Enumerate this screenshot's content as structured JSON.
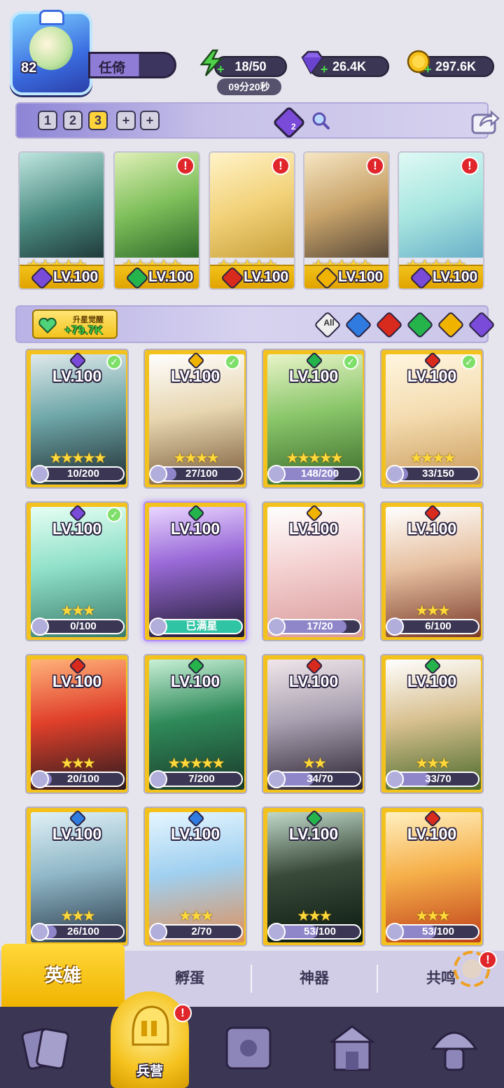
{
  "player": {
    "level": "82",
    "name": "任倚"
  },
  "resources": {
    "energy": "18/50",
    "energy_timer": "09分20秒",
    "gems": "26.4K",
    "coins": "297.6K"
  },
  "team_slots": [
    "1",
    "2",
    "3",
    "+",
    "+"
  ],
  "team_badge_count": "2",
  "team": [
    {
      "level": "LV.100",
      "element": "purple",
      "alert": false
    },
    {
      "level": "LV.100",
      "element": "green",
      "alert": true
    },
    {
      "level": "LV.100",
      "element": "red",
      "alert": true
    },
    {
      "level": "LV.100",
      "element": "gold",
      "alert": true
    },
    {
      "level": "LV.100",
      "element": "purple",
      "alert": true
    }
  ],
  "awaken": {
    "label": "升星觉醒",
    "value": "+79.7K"
  },
  "filters": {
    "all_label": "All",
    "elements": [
      "blue",
      "red",
      "green",
      "gold",
      "purple"
    ]
  },
  "heroes": [
    {
      "level": "LV.100",
      "frag": "10/200",
      "checked": true,
      "element": "purple",
      "stars": 5
    },
    {
      "level": "LV.100",
      "frag": "27/100",
      "checked": true,
      "element": "gold",
      "stars": 4
    },
    {
      "level": "LV.100",
      "frag": "148/200",
      "checked": true,
      "element": "green",
      "stars": 5
    },
    {
      "level": "LV.100",
      "frag": "33/150",
      "checked": true,
      "element": "red",
      "stars": 4
    },
    {
      "level": "LV.100",
      "frag": "0/100",
      "checked": true,
      "element": "purple",
      "stars": 3
    },
    {
      "level": "LV.100",
      "frag": "已满星",
      "checked": false,
      "element": "green",
      "stars": 0,
      "maxed": true
    },
    {
      "level": "LV.100",
      "frag": "17/20",
      "checked": false,
      "element": "gold",
      "stars": 0
    },
    {
      "level": "LV.100",
      "frag": "6/100",
      "checked": false,
      "element": "red",
      "stars": 3
    },
    {
      "level": "LV.100",
      "frag": "20/100",
      "checked": false,
      "element": "red",
      "stars": 3
    },
    {
      "level": "LV.100",
      "frag": "7/200",
      "checked": false,
      "element": "green",
      "stars": 5
    },
    {
      "level": "LV.100",
      "frag": "34/70",
      "checked": false,
      "element": "red",
      "stars": 2
    },
    {
      "level": "LV.100",
      "frag": "33/70",
      "checked": false,
      "element": "green",
      "stars": 3
    },
    {
      "level": "LV.100",
      "frag": "26/100",
      "checked": false,
      "element": "blue",
      "stars": 3
    },
    {
      "level": "LV.100",
      "frag": "2/70",
      "checked": false,
      "element": "blue",
      "stars": 3
    },
    {
      "level": "LV.100",
      "frag": "53/100",
      "checked": false,
      "element": "green",
      "stars": 3
    },
    {
      "level": "LV.100",
      "frag": "53/100",
      "checked": false,
      "element": "red",
      "stars": 3
    }
  ],
  "subtabs": [
    "英雄",
    "孵蛋",
    "神器",
    "共鸣"
  ],
  "nav": {
    "barracks_label": "兵营"
  },
  "colors": {
    "purple": "#7a4ad8",
    "green": "#25b44c",
    "red": "#d92a1e",
    "gold": "#f0b400",
    "blue": "#2f7be0"
  }
}
